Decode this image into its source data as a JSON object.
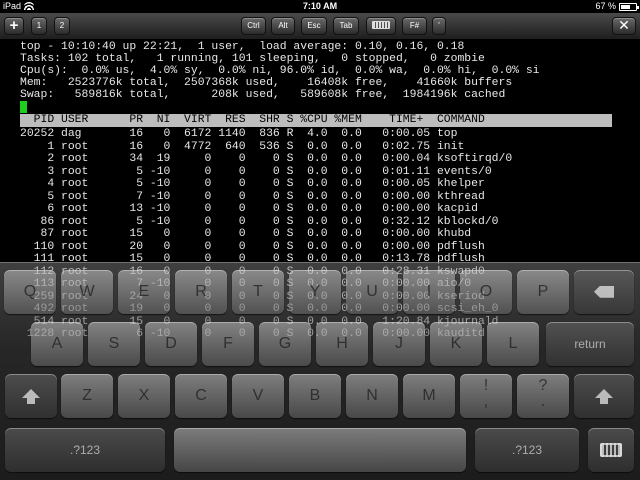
{
  "status_bar": {
    "device": "iPad",
    "time": "7:10 AM",
    "battery": "67 %",
    "battery_level": 0.67
  },
  "toolbar": {
    "new_tab": "+",
    "tab1": "1",
    "tab2": "2",
    "ctrl": "Ctrl",
    "alt": "Alt",
    "esc": "Esc",
    "tab": "Tab",
    "fn": "F#",
    "extra": "'",
    "close": "✕"
  },
  "terminal": {
    "summary": [
      "top - 10:10:40 up 22:21,  1 user,  load average: 0.10, 0.16, 0.18",
      "Tasks: 102 total,   1 running, 101 sleeping,   0 stopped,   0 zombie",
      "Cpu(s):  0.0% us,  4.0% sy,  0.0% ni, 96.0% id,  0.0% wa,  0.0% hi,  0.0% si",
      "Mem:   2523776k total,  2507368k used,    16408k free,    41660k buffers",
      "Swap:   589816k total,      208k used,   589608k free,  1984196k cached"
    ],
    "header": "  PID USER      PR  NI  VIRT  RES  SHR S %CPU %MEM    TIME+  COMMAND",
    "rows": [
      "20252 dag       16   0  6172 1140  836 R  4.0  0.0   0:00.05 top",
      "    1 root      16   0  4772  640  536 S  0.0  0.0   0:02.75 init",
      "    2 root      34  19     0    0    0 S  0.0  0.0   0:00.04 ksoftirqd/0",
      "    3 root       5 -10     0    0    0 S  0.0  0.0   0:01.11 events/0",
      "    4 root       5 -10     0    0    0 S  0.0  0.0   0:00.05 khelper",
      "    5 root       7 -10     0    0    0 S  0.0  0.0   0:00.00 kthread",
      "    6 root      13 -10     0    0    0 S  0.0  0.0   0:00.00 kacpid",
      "   86 root       5 -10     0    0    0 S  0.0  0.0   0:32.12 kblockd/0",
      "   87 root      15   0     0    0    0 S  0.0  0.0   0:00.00 khubd",
      "  110 root      20   0     0    0    0 S  0.0  0.0   0:00.00 pdflush",
      "  111 root      15   0     0    0    0 S  0.0  0.0   0:13.78 pdflush",
      "  112 root      16   0     0    0    0 S  0.0  0.0   0:28.31 kswapd0",
      "  113 root       7 -10     0    0    0 S  0.0  0.0   0:00.00 aio/0",
      "  259 root      24   0     0    0    0 S  0.0  0.0   0:00.00 kseriod",
      "  492 root      19   0     0    0    0 S  0.0  0.0   0:00.00 scsi_eh_0",
      "  514 root      15   0     0    0    0 S  0.0  0.0   1:20.84 kjournald",
      " 1228 root       6 -10     0    0    0 S  0.0  0.0   0:00.00 kauditd"
    ]
  },
  "keyboard": {
    "row1": [
      "Q",
      "W",
      "E",
      "R",
      "T",
      "Y",
      "U",
      "I",
      "O",
      "P"
    ],
    "row2": [
      "A",
      "S",
      "D",
      "F",
      "G",
      "H",
      "J",
      "K",
      "L"
    ],
    "row3": [
      "Z",
      "X",
      "C",
      "V",
      "B",
      "N",
      "M"
    ],
    "return": "return",
    "numbers": ".?123",
    "excl_top": "!",
    "excl_bot": ",",
    "quest_top": "?",
    "quest_bot": "."
  },
  "colors": {
    "cursor": "#1ecf1e",
    "header_bar": "#bdbdbd",
    "terminal_bg": "#000000",
    "terminal_fg": "#e8e8e8"
  }
}
